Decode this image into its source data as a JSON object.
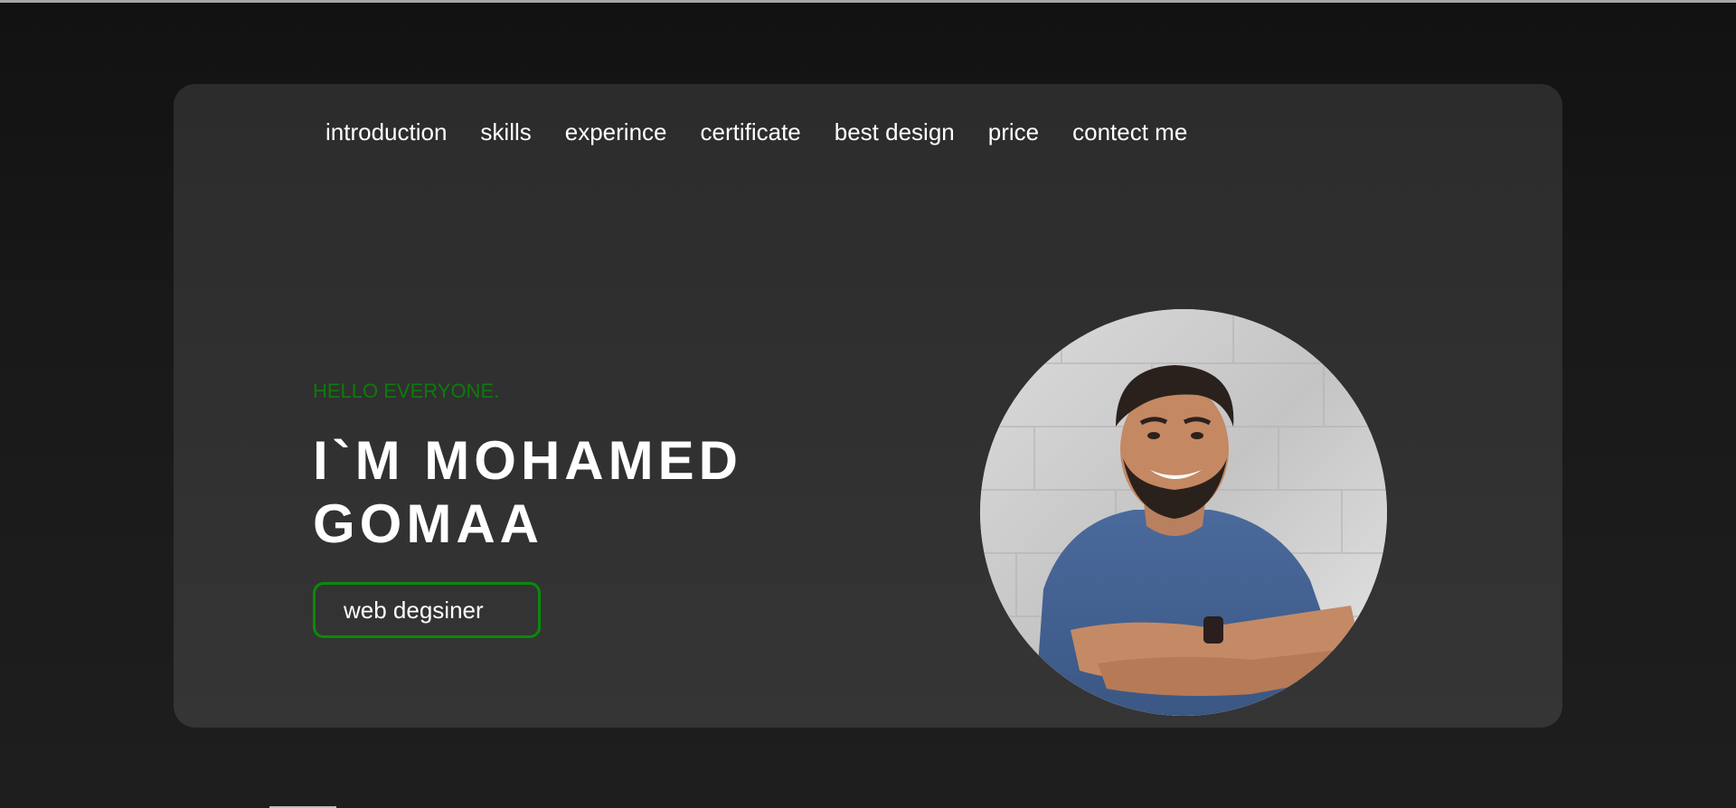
{
  "nav": {
    "items": [
      {
        "label": "introduction"
      },
      {
        "label": "skills"
      },
      {
        "label": "experince"
      },
      {
        "label": "certificate"
      },
      {
        "label": "best design"
      },
      {
        "label": "price"
      },
      {
        "label": "contect me"
      }
    ]
  },
  "hero": {
    "greeting": "HELLO EVERYONE.",
    "name_line1": "I`M MOHAMED",
    "name_line2": "GOMAA",
    "role_button": "web degsiner"
  },
  "colors": {
    "page_background": "#141414",
    "card_background": "#303030",
    "accent_green": "#0a8a0a",
    "text": "#ffffff"
  },
  "icons": {
    "profile_photo": "profile-photo"
  }
}
